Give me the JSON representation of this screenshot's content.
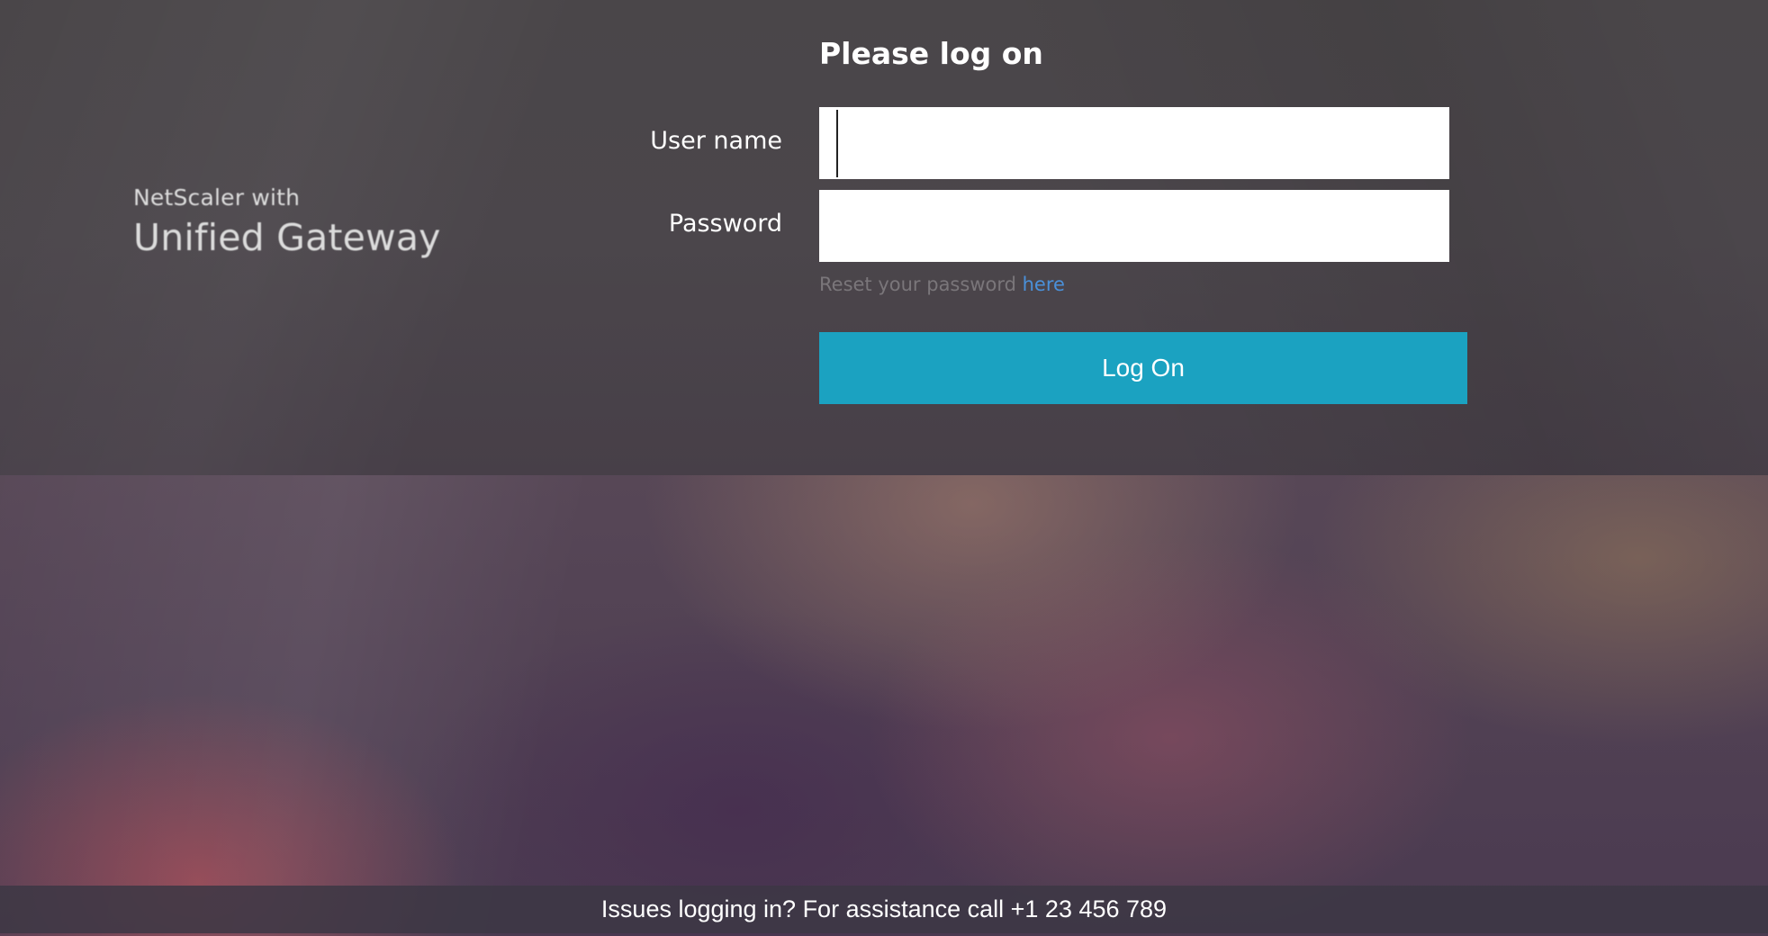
{
  "brand": {
    "subtitle": "NetScaler with",
    "title": "Unified Gateway"
  },
  "login": {
    "title": "Please log on",
    "username_label": "User name",
    "username_value": "",
    "password_label": "Password",
    "password_value": "",
    "reset_text": "Reset your password",
    "reset_link": "here",
    "submit_label": "Log On"
  },
  "footer": {
    "text": "Issues logging in? For assistance call +1 23 456 789"
  },
  "colors": {
    "accent": "#1ba2c1",
    "link": "#4a90d9"
  }
}
